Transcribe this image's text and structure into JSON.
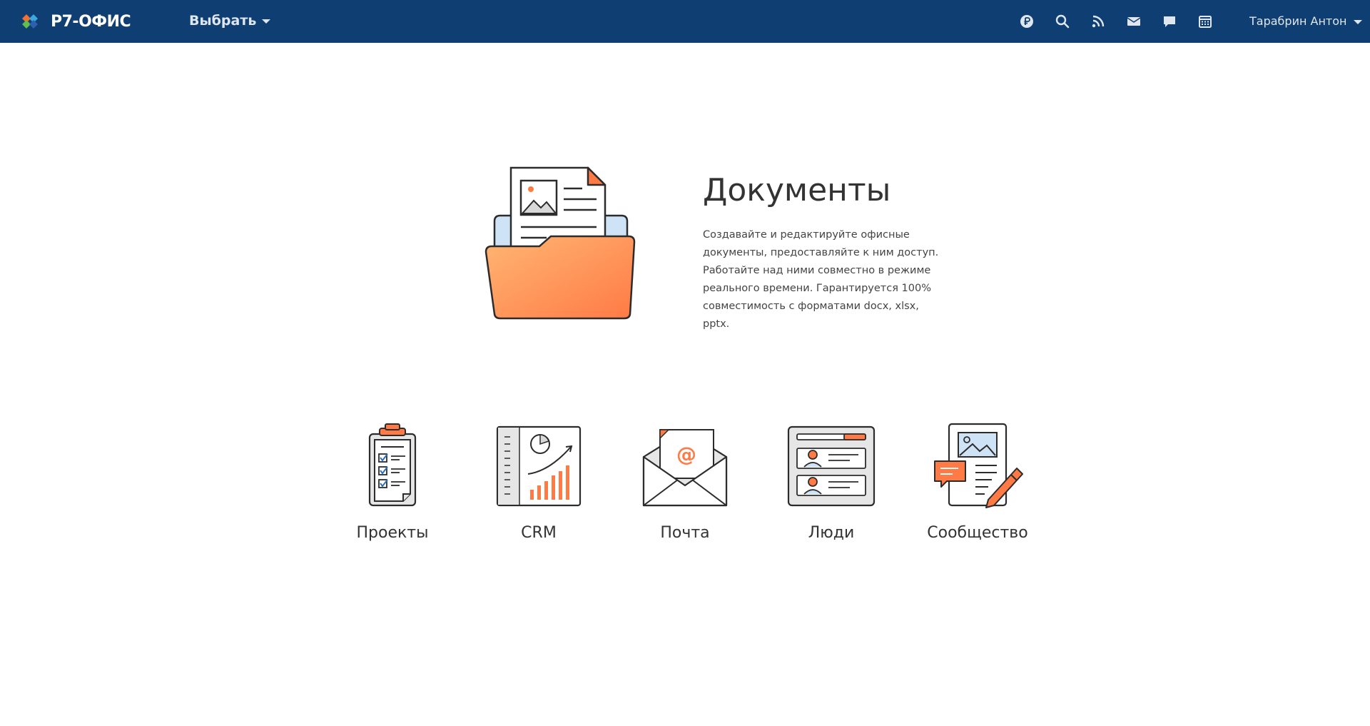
{
  "header": {
    "logo_text": "Р7-ОФИС",
    "select_label": "Выбрать",
    "icons": [
      "ruble-icon",
      "search-icon",
      "feed-icon",
      "mail-icon",
      "chat-icon",
      "calendar-icon"
    ],
    "user_name": "Тарабрин Антон",
    "background": "#0f3e73"
  },
  "hero": {
    "title": "Документы",
    "description": "Создавайте и редактируйте офисные документы, предоставляйте к ним доступ. Работайте над ними совместно в режиме реального времени. Гарантируется 100% совместимость с форматами docx, xlsx, pptx."
  },
  "modules": [
    {
      "label": "Проекты",
      "icon": "projects-icon"
    },
    {
      "label": "CRM",
      "icon": "crm-icon"
    },
    {
      "label": "Почта",
      "icon": "mail-module-icon"
    },
    {
      "label": "Люди",
      "icon": "people-icon"
    },
    {
      "label": "Сообщество",
      "icon": "community-icon"
    }
  ],
  "accent_color": "#ff7a45"
}
